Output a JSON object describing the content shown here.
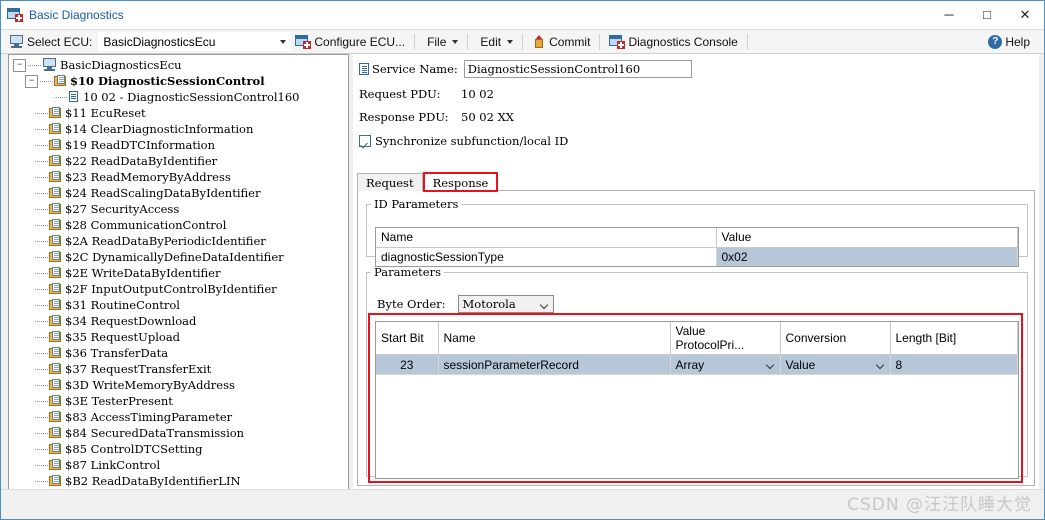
{
  "window": {
    "title": "Basic Diagnostics",
    "icon": "diagnostics-app-icon",
    "minimize": "─",
    "maximize": "□",
    "close": "✕"
  },
  "toolbar": {
    "select_ecu_label": "Select ECU:",
    "select_ecu_value": "BasicDiagnosticsEcu",
    "configure_ecu": "Configure ECU...",
    "file": "File",
    "edit": "Edit",
    "commit": "Commit",
    "diagnostics_console": "Diagnostics Console",
    "help": "Help",
    "help_glyph": "?"
  },
  "tree": {
    "root": "BasicDiagnosticsEcu",
    "root_expander": "−",
    "service_expander": "−",
    "service": "$10 DiagnosticSessionControl",
    "service_child": "10 02 - DiagnosticSessionControl160",
    "items": [
      "$11 EcuReset",
      "$14 ClearDiagnosticInformation",
      "$19 ReadDTCInformation",
      "$22 ReadDataByIdentifier",
      "$23 ReadMemoryByAddress",
      "$24 ReadScalingDataByIdentifier",
      "$27 SecurityAccess",
      "$28 CommunicationControl",
      "$2A ReadDataByPeriodicIdentifier",
      "$2C DynamicallyDefineDataIdentifier",
      "$2E WriteDataByIdentifier",
      "$2F InputOutputControlByIdentifier",
      "$31 RoutineControl",
      "$34 RequestDownload",
      "$35 RequestUpload",
      "$36 TransferData",
      "$37 RequestTransferExit",
      "$3D WriteMemoryByAddress",
      "$3E TesterPresent",
      "$83 AccessTimingParameter",
      "$84 SecuredDataTransmission",
      "$85 ControlDTCSetting",
      "$87 LinkControl",
      "$B2 ReadDataByIdentifierLIN"
    ]
  },
  "detail": {
    "service_name_label": "Service Name:",
    "service_name_value": "DiagnosticSessionControl160",
    "request_pdu_label": "Request PDU:",
    "request_pdu_value": "10 02",
    "response_pdu_label": "Response PDU:",
    "response_pdu_value": "50 02 XX",
    "sync_checkbox_label": "Synchronize subfunction/local ID",
    "sync_checked": true,
    "tabs": [
      {
        "label": "Request",
        "active": false
      },
      {
        "label": "Response",
        "active": true,
        "highlighted": true
      }
    ],
    "id_parameters": {
      "legend": "ID Parameters",
      "columns": [
        "Name",
        "Value"
      ],
      "rows": [
        {
          "name": "diagnosticSessionType",
          "value": "0x02",
          "value_selected": true
        }
      ]
    },
    "parameters": {
      "legend": "Parameters",
      "byte_order_label": "Byte Order:",
      "byte_order_value": "Motorola",
      "columns": [
        "Start Bit",
        "Name",
        "Value ProtocolPri...",
        "Conversion",
        "Length [Bit]"
      ],
      "rows": [
        {
          "start_bit": "23",
          "name": "sessionParameterRecord",
          "value_protocol": "Array",
          "conversion": "Value",
          "length": "8",
          "selected": true
        }
      ]
    }
  },
  "annotations": {
    "highlight_color": "#e8121d"
  },
  "statusbar": {
    "watermark": "CSDN @汪汪队睡大觉"
  }
}
